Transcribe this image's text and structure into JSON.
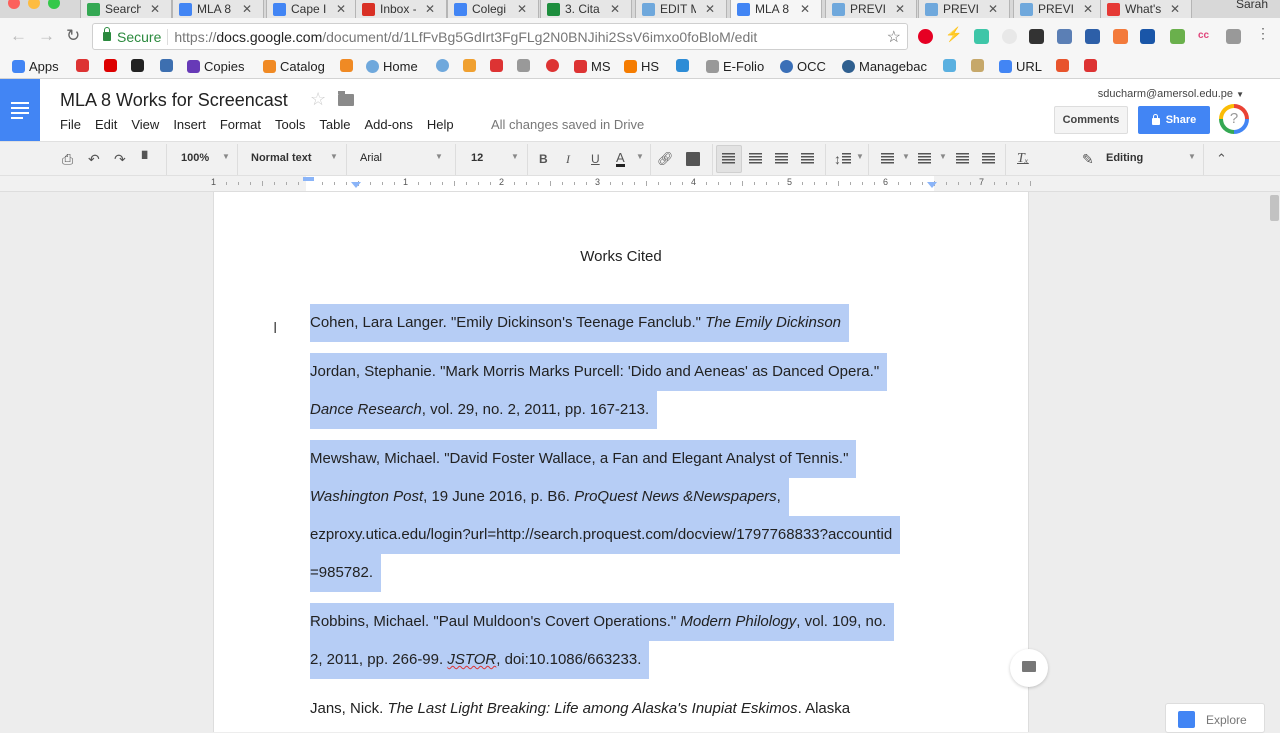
{
  "browser": {
    "user_name": "Sarah",
    "tabs": [
      {
        "label": "Search",
        "icon": "google-drive-icon",
        "color": "#34a853",
        "active": false
      },
      {
        "label": "MLA 8",
        "icon": "google-docs-icon",
        "color": "#4285f4",
        "active": false
      },
      {
        "label": "Cape I",
        "icon": "google-docs-icon",
        "color": "#4285f4",
        "active": false
      },
      {
        "label": "Inbox -",
        "icon": "gmail-icon",
        "color": "#d93025",
        "active": false
      },
      {
        "label": "Colegi",
        "icon": "calendar-icon",
        "color": "#4285f4",
        "active": false
      },
      {
        "label": "3. Cita",
        "icon": "google-classroom-icon",
        "color": "#1e8e3e",
        "active": false
      },
      {
        "label": "EDIT M",
        "icon": "cloud-icon",
        "color": "#6fa8dc",
        "active": false
      },
      {
        "label": "MLA 8",
        "icon": "google-docs-icon",
        "color": "#4285f4",
        "active": true
      },
      {
        "label": "PREVI",
        "icon": "cloud-icon",
        "color": "#6fa8dc",
        "active": false
      },
      {
        "label": "PREVI",
        "icon": "cloud-icon",
        "color": "#6fa8dc",
        "active": false
      },
      {
        "label": "PREVI",
        "icon": "cloud-icon",
        "color": "#6fa8dc",
        "active": false
      },
      {
        "label": "What's",
        "icon": "site-icon",
        "color": "#e53935",
        "active": false
      }
    ],
    "address": {
      "secure_label": "Secure",
      "url_scheme": "https://",
      "url_host": "docs.google.com",
      "url_path": "/document/d/1LfFvBg5GdIrt3FgFLg2N0BNJihi2SsV6imxo0foBloM/edit"
    },
    "bookmarks": [
      {
        "label": "Apps",
        "icon": "apps-grid-icon",
        "color": "#4285f4"
      },
      {
        "label": "",
        "icon": "bookmark-icon",
        "color": "#d33"
      },
      {
        "label": "",
        "icon": "bookmark-icon",
        "color": "#d00"
      },
      {
        "label": "",
        "icon": "7m-icon",
        "color": "#222"
      },
      {
        "label": "",
        "icon": "bookmark-icon",
        "color": "#3d6fb0"
      },
      {
        "label": "Copies",
        "icon": "form-icon",
        "color": "#673ab7"
      },
      {
        "label": "Catalog",
        "icon": "catalog-icon",
        "color": "#f08a24"
      },
      {
        "label": "",
        "icon": "catalog-icon",
        "color": "#f08a24"
      },
      {
        "label": "Home",
        "icon": "cloud-icon",
        "color": "#6fa8dc"
      },
      {
        "label": "",
        "icon": "cloud-icon",
        "color": "#6fa8dc"
      },
      {
        "label": "",
        "icon": "bookmark-icon",
        "color": "#f0a030"
      },
      {
        "label": "",
        "icon": "bookmark-icon",
        "color": "#d33"
      },
      {
        "label": "",
        "icon": "bookmark-icon",
        "color": "#999"
      },
      {
        "label": "",
        "icon": "stop-icon",
        "color": "#d33"
      },
      {
        "label": "MS",
        "icon": "bookmark-icon",
        "color": "#d33"
      },
      {
        "label": "HS",
        "icon": "blogger-icon",
        "color": "#f57c00"
      },
      {
        "label": "",
        "icon": "z-icon",
        "color": "#2d8cd6"
      },
      {
        "label": "E-Folio",
        "icon": "page-icon",
        "color": "#999"
      },
      {
        "label": "OCC",
        "icon": "occ-icon",
        "color": "#3a6fb7"
      },
      {
        "label": "Managebac",
        "icon": "managebac-icon",
        "color": "#2f5f8f"
      },
      {
        "label": "",
        "icon": "bookmark-icon",
        "color": "#5ab0e0"
      },
      {
        "label": "",
        "icon": "g-icon",
        "color": "#c6a86a"
      },
      {
        "label": "URL",
        "icon": "google-icon",
        "color": "#4285f4"
      },
      {
        "label": "",
        "icon": "bookmark-icon",
        "color": "#e8542c"
      },
      {
        "label": "",
        "icon": "gauge-icon",
        "color": "#d33"
      }
    ]
  },
  "docs": {
    "title": "MLA 8 Works for Screencast",
    "menu": [
      "File",
      "Edit",
      "View",
      "Insert",
      "Format",
      "Tools",
      "Table",
      "Add-ons",
      "Help"
    ],
    "save_status": "All changes saved in Drive",
    "account": "sducharm@amersol.edu.pe",
    "comments_label": "Comments",
    "share_label": "Share",
    "accent": "#4285f4",
    "selection_color": "#b6cdf5"
  },
  "toolbar": {
    "zoom": "100%",
    "style": "Normal text",
    "font": "Arial",
    "size": "12",
    "bold": "B",
    "italic": "I",
    "underline": "U",
    "text_color": "A",
    "mode": "Editing"
  },
  "ruler": {
    "labels": [
      "1",
      "1",
      "2",
      "3",
      "4",
      "5",
      "6",
      "7"
    ]
  },
  "document": {
    "heading": "Works Cited",
    "lines": [
      {
        "parts": [
          {
            "t": "Cohen, Lara Langer. \"Emily Dickinson's Teenage Fanclub.\" "
          },
          {
            "t": "The Emily Dickinson",
            "i": true
          }
        ],
        "selected": true
      },
      {
        "parts": [
          {
            "t": "Jordan, Stephanie. \"Mark Morris Marks Purcell: 'Dido and Aeneas' as Danced Opera.\""
          }
        ],
        "selected": true
      },
      {
        "parts": [
          {
            "t": "Dance Research",
            "i": true
          },
          {
            "t": ", vol. 29, no. 2, 2011, pp. 167-213."
          }
        ],
        "selected": true
      },
      {
        "parts": [
          {
            "t": "Mewshaw, Michael. \"David Foster Wallace, a Fan and Elegant Analyst of Tennis.\""
          }
        ],
        "selected": true
      },
      {
        "parts": [
          {
            "t": "Washington Post",
            "i": true
          },
          {
            "t": ", 19 June 2016, p. B6. "
          },
          {
            "t": "ProQuest News &Newspapers",
            "i": true
          },
          {
            "t": ","
          }
        ],
        "selected": true
      },
      {
        "parts": [
          {
            "t": "ezproxy.utica.edu/login?url=http://search.proquest.com/docview/1797768833?accountid"
          }
        ],
        "selected": true
      },
      {
        "parts": [
          {
            "t": "=985782."
          }
        ],
        "selected": true
      },
      {
        "parts": [
          {
            "t": "Robbins, Michael. \"Paul Muldoon's Covert Operations.\" "
          },
          {
            "t": "Modern Philology",
            "i": true
          },
          {
            "t": ", vol. 109, no."
          }
        ],
        "selected": true
      },
      {
        "parts": [
          {
            "t": "2, 2011, pp. 266-99. "
          },
          {
            "t": "JSTOR",
            "i": true,
            "spell": true
          },
          {
            "t": ", doi:10.1086/663233."
          }
        ],
        "selected": true
      },
      {
        "parts": [
          {
            "t": "Jans, Nick. "
          },
          {
            "t": "The Last Light Breaking: Life among Alaska's Inupiat Eskimos",
            "i": true
          },
          {
            "t": ". Alaska"
          }
        ],
        "selected": false
      }
    ]
  },
  "explore_label": "Explore"
}
